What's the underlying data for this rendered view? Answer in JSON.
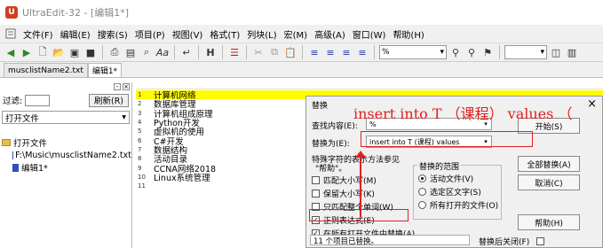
{
  "window": {
    "app_title": "UltraEdit-32 - [编辑1*]"
  },
  "menu": [
    "文件(F)",
    "编辑(E)",
    "搜索(S)",
    "项目(P)",
    "视图(V)",
    "格式(T)",
    "列块(L)",
    "宏(M)",
    "高级(A)",
    "窗口(W)",
    "帮助(H)"
  ],
  "toolbar": {
    "font_combo": "%"
  },
  "tabs": [
    "musclistName2.txt",
    "编辑1*"
  ],
  "left_panel": {
    "filter_label": "过滤:",
    "refresh_button": "刷新(R)",
    "open_files_select": "打开文件",
    "tree_root": "打开文件",
    "tree_items": [
      "F:\\Music\\musclistName2.txt",
      "编辑1*"
    ]
  },
  "editor": {
    "lines": [
      {
        "num": "1",
        "text": "计算机网络"
      },
      {
        "num": "2",
        "text": "数据库管理"
      },
      {
        "num": "3",
        "text": "计算机组成原理"
      },
      {
        "num": "4",
        "text": "Python开发"
      },
      {
        "num": "5",
        "text": "虚拟机的使用"
      },
      {
        "num": "6",
        "text": "C#开发"
      },
      {
        "num": "7",
        "text": "数据结构"
      },
      {
        "num": "8",
        "text": "活动目录"
      },
      {
        "num": "9",
        "text": "CCNA网络2018"
      },
      {
        "num": "10",
        "text": "Linux系统管理"
      },
      {
        "num": "11",
        "text": ""
      }
    ]
  },
  "dialog": {
    "title": "替换",
    "close": "×",
    "find_label": "查找内容(E):",
    "find_value": "%",
    "replace_label": "替换为(E):",
    "replace_value": "insert into T (课程) values",
    "hint_line1": "特殊字符的表示方法参见",
    "hint_line2": "\"帮助\"。",
    "match_whole_word": "匹配大小写(M)",
    "match_case": "保留大小写(K)",
    "whole_word": "只匹配整个单词(W)",
    "regex": "正则表达式(E)",
    "replace_all_open": "在所有打开文件中替换(A)",
    "scope_title": "替换的范围",
    "scope_active": "活动文件(V)",
    "scope_selection": "选定区文字(S)",
    "scope_all_open": "所有打开的文件(O)",
    "btn_start": "开始(S)",
    "btn_replace_all": "全部替换(A)",
    "btn_cancel": "取消(C)",
    "btn_help": "帮助(H)",
    "status": "11 个项目已替换。",
    "close_after": "替换后关闭(F)"
  },
  "annotation": {
    "text": "insert into T （课程） values （"
  },
  "colors": {
    "highlight": "#fffc00",
    "annotation": "#e02020"
  }
}
